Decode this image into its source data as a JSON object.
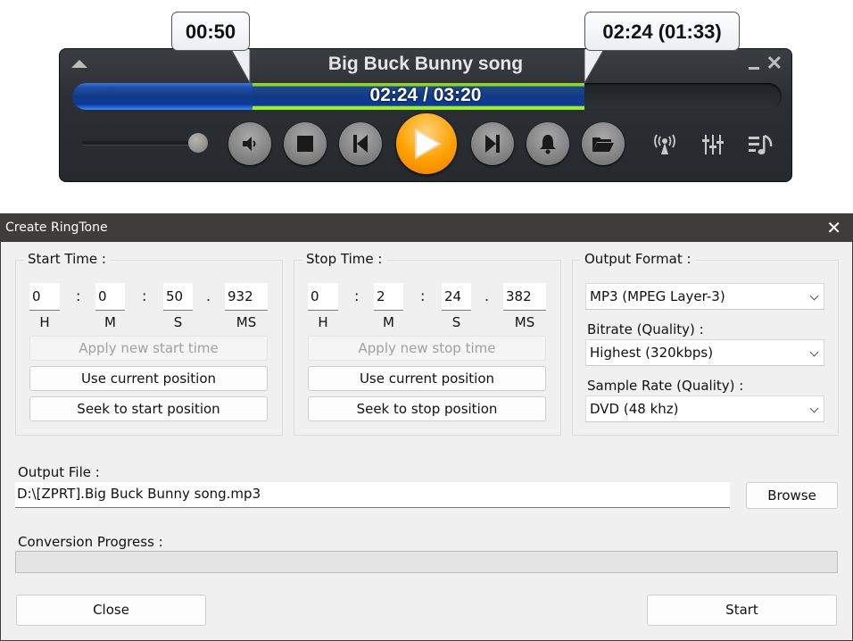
{
  "player": {
    "title": "Big Buck Bunny song",
    "time_display": "02:24 / 03:20",
    "start_bubble": "00:50",
    "stop_bubble": "02:24 (01:33)",
    "total_seconds": 200,
    "current_seconds": 144,
    "selection_start_seconds": 50.932,
    "selection_stop_seconds": 144.382,
    "volume_fraction": 1.0,
    "colors": {
      "played": "#1d4fae",
      "selection": "#9ef21e",
      "play_button": "#ffa000"
    },
    "buttons": [
      {
        "name": "mute-button",
        "icon": "speaker-icon"
      },
      {
        "name": "stop-button",
        "icon": "stop-icon"
      },
      {
        "name": "previous-button",
        "icon": "previous-icon"
      },
      {
        "name": "play-button",
        "icon": "play-icon"
      },
      {
        "name": "next-button",
        "icon": "next-icon"
      },
      {
        "name": "alarm-button",
        "icon": "bell-icon"
      },
      {
        "name": "open-button",
        "icon": "folder-icon"
      },
      {
        "name": "broadcast-button",
        "icon": "broadcast-icon"
      },
      {
        "name": "equalizer-button",
        "icon": "equalizer-icon"
      },
      {
        "name": "playlist-button",
        "icon": "playlist-icon"
      }
    ]
  },
  "dialog": {
    "title": "Create RingTone",
    "close_glyph": "✕",
    "start_time": {
      "label": "Start Time :",
      "h": "0",
      "m": "0",
      "s": "50",
      "ms": "932",
      "units": {
        "h": "H",
        "m": "M",
        "s": "S",
        "ms": "MS"
      },
      "apply_label": "Apply new start time",
      "use_current_label": "Use current position",
      "seek_label": "Seek to start position"
    },
    "stop_time": {
      "label": "Stop Time :",
      "h": "0",
      "m": "2",
      "s": "24",
      "ms": "382",
      "units": {
        "h": "H",
        "m": "M",
        "s": "S",
        "ms": "MS"
      },
      "apply_label": "Apply new stop time",
      "use_current_label": "Use current position",
      "seek_label": "Seek to stop position"
    },
    "separators": {
      "colon": ":",
      "dot": "."
    },
    "output_format": {
      "label": "Output Format :",
      "format_value": "MP3 (MPEG Layer-3)",
      "bitrate_label": "Bitrate (Quality) :",
      "bitrate_value": "Highest (320kbps)",
      "samplerate_label": "Sample Rate (Quality) :",
      "samplerate_value": "DVD (48 khz)"
    },
    "output_file": {
      "label": "Output File :",
      "value": "D:\\[ZPRT].Big Buck Bunny song.mp3",
      "browse_label": "Browse"
    },
    "progress": {
      "label": "Conversion Progress :",
      "percent": 0
    },
    "close_label": "Close",
    "start_label": "Start"
  }
}
